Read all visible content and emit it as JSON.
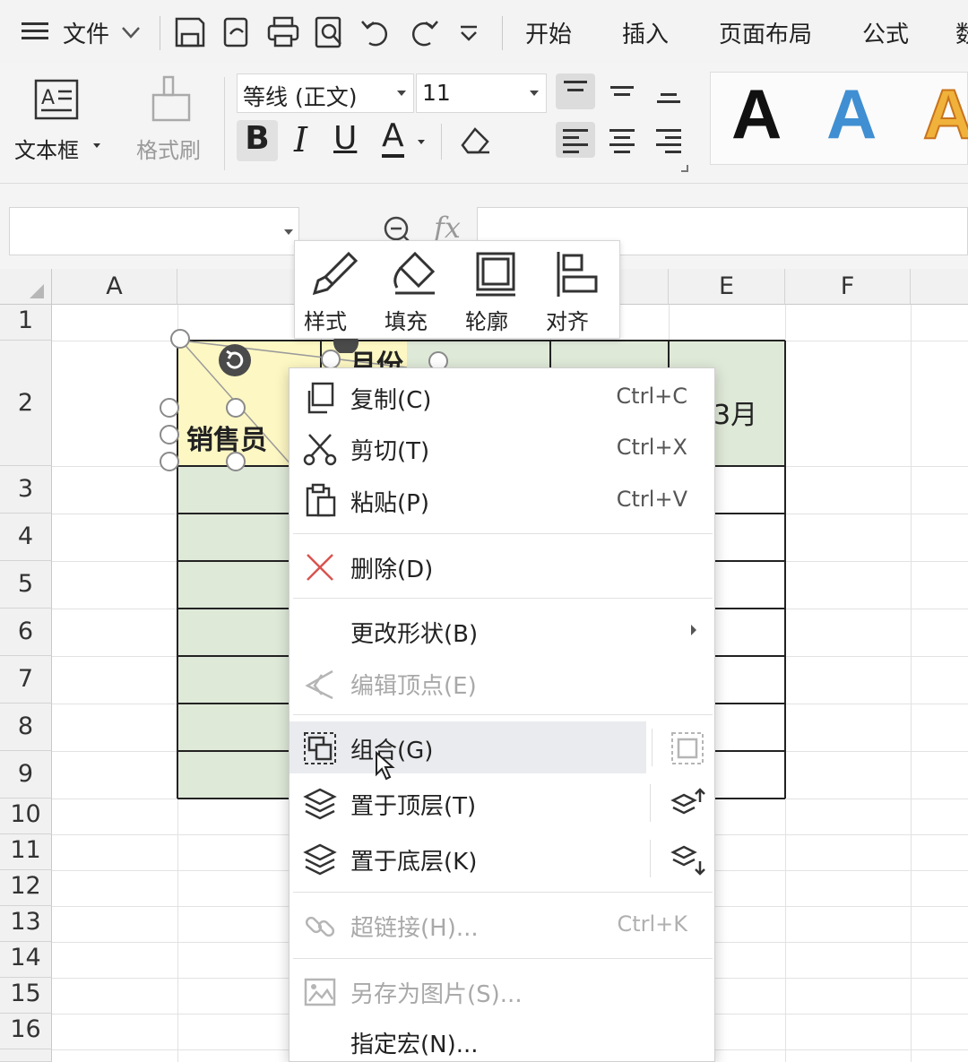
{
  "menubar": {
    "file_label": "文件",
    "tabs": [
      "开始",
      "插入",
      "页面布局",
      "公式",
      "数"
    ]
  },
  "ribbon": {
    "textbox_label": "文本框",
    "format_painter_label": "格式刷",
    "font_name": "等线 (正文)",
    "font_size": "11",
    "bold": "B",
    "italic": "I",
    "underline": "U",
    "font_color": "A",
    "style_letters": [
      "A",
      "A",
      "A"
    ],
    "style_colors": [
      "#111111",
      "#3f8fd2",
      "#f0b23a"
    ]
  },
  "formula_bar": {
    "fx_label": "fx"
  },
  "sheet": {
    "columns": [
      "A",
      "",
      "",
      "",
      "E",
      "F"
    ],
    "rows": [
      "1",
      "2",
      "3",
      "4",
      "5",
      "6",
      "7",
      "8",
      "9",
      "10",
      "11",
      "12",
      "13",
      "14",
      "15",
      "16"
    ],
    "cells": {
      "salesperson": "销售员",
      "month_header": "月份",
      "march": "3月"
    },
    "header_fill": "#dfe9d8",
    "selected_fill": "#fdf7c3"
  },
  "shape_toolbar": {
    "items": [
      {
        "label": "样式",
        "icon": "brush-icon"
      },
      {
        "label": "填充",
        "icon": "fill-bucket-icon"
      },
      {
        "label": "轮廓",
        "icon": "outline-icon"
      },
      {
        "label": "对齐",
        "icon": "align-icon"
      }
    ]
  },
  "context_menu": {
    "copy": {
      "label": "复制(C)",
      "shortcut": "Ctrl+C"
    },
    "cut": {
      "label": "剪切(T)",
      "shortcut": "Ctrl+X"
    },
    "paste": {
      "label": "粘贴(P)",
      "shortcut": "Ctrl+V"
    },
    "delete": {
      "label": "删除(D)"
    },
    "change_shape": {
      "label": "更改形状(B)"
    },
    "edit_points": {
      "label": "编辑顶点(E)"
    },
    "group": {
      "label": "组合(G)"
    },
    "bring_to_front": {
      "label": "置于顶层(T)"
    },
    "send_to_back": {
      "label": "置于底层(K)"
    },
    "hyperlink": {
      "label": "超链接(H)...",
      "shortcut": "Ctrl+K"
    },
    "save_as_picture": {
      "label": "另存为图片(S)..."
    },
    "assign_macro": {
      "label": "指定宏(N)..."
    }
  }
}
